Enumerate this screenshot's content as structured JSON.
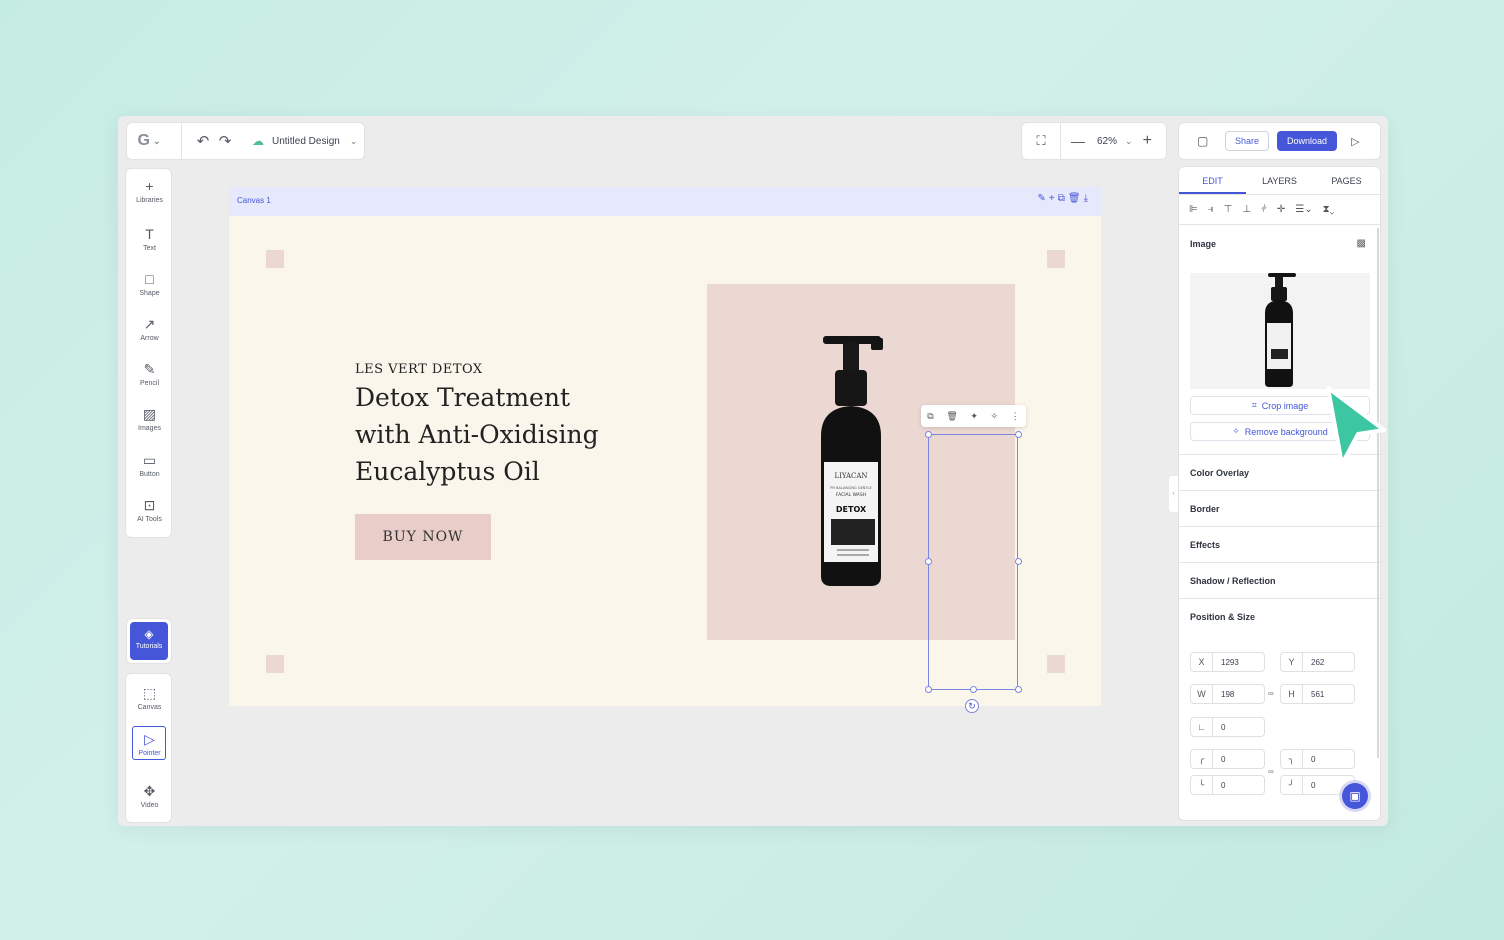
{
  "topbar": {
    "undo_icon": "↶",
    "redo_icon": "↷",
    "design_title": "Untitled Design"
  },
  "zoom": {
    "level": "62%"
  },
  "actions": {
    "share_label": "Share",
    "download_label": "Download"
  },
  "left_tools": [
    {
      "icon": "+",
      "label": "Libraries",
      "name": "libraries"
    },
    {
      "icon": "T",
      "label": "Text",
      "name": "text"
    },
    {
      "icon": "□",
      "label": "Shape",
      "name": "shape"
    },
    {
      "icon": "↗",
      "label": "Arrow",
      "name": "arrow"
    },
    {
      "icon": "✎",
      "label": "Pencil",
      "name": "pencil"
    },
    {
      "icon": "▨",
      "label": "Images",
      "name": "images"
    },
    {
      "icon": "▭",
      "label": "Button",
      "name": "button"
    },
    {
      "icon": "⊡",
      "label": "AI Tools",
      "name": "ai-tools"
    }
  ],
  "tutorials_label": "Tutorials",
  "lower_tools": [
    {
      "icon": "⬚",
      "label": "Canvas",
      "name": "canvas"
    },
    {
      "icon": "▷",
      "label": "Pointer",
      "name": "pointer"
    },
    {
      "icon": "✥",
      "label": "Video",
      "name": "video"
    }
  ],
  "canvas": {
    "label": "Canvas 1",
    "brand": "LES VERT DETOX",
    "headline_lines": [
      "Detox Treatment",
      "with Anti-Oxidising",
      "Eucalyptus Oil"
    ],
    "cta": "BUY NOW",
    "colors": {
      "background": "#faf6eb",
      "accent_pink": "#ecd8d2",
      "cta": "#e8cdc8"
    }
  },
  "product": {
    "brand": "LIYACAN",
    "line1": "PH BALANCING GENTLE",
    "line2": "FACIAL WASH",
    "name": "DETOX"
  },
  "right_panel": {
    "tabs": [
      "EDIT",
      "LAYERS",
      "PAGES"
    ],
    "image_title": "Image",
    "crop_label": "Crop image",
    "remove_bg_label": "Remove background",
    "sections": [
      "Color Overlay",
      "Border",
      "Effects",
      "Shadow / Reflection",
      "Position & Size"
    ],
    "position": {
      "x": "1293",
      "y": "262",
      "w": "198",
      "h": "561",
      "rotation": "0"
    },
    "radius": {
      "tl": "0",
      "tr": "0",
      "bl": "0",
      "br": "0"
    }
  },
  "accent": "#4656d8"
}
